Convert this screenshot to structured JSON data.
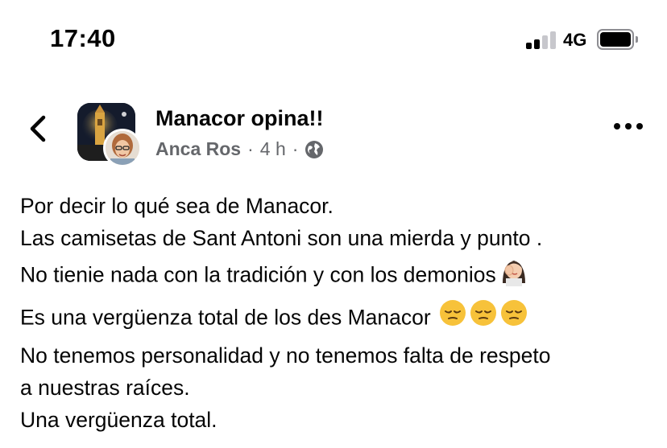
{
  "status_bar": {
    "time": "17:40",
    "network": "4G",
    "signal_icon": "cellular-signal-icon",
    "battery_icon": "battery-icon"
  },
  "header": {
    "back_icon": "chevron-left-icon",
    "group_name": "Manacor opina!!",
    "author": "Anca Ros",
    "separator_1": "·",
    "time_ago": "4 h",
    "separator_2": "·",
    "privacy_icon": "globe-icon",
    "more_icon": "more-horizontal-icon"
  },
  "post": {
    "lines": [
      "Por decir lo qué sea de Manacor.",
      "Las camisetas de Sant Antoni son una mierda y punto .",
      "No tienie nada con la tradición y con los demonios",
      "Es una vergüenza total de los des Manacor",
      "No tenemos personalidad y no tenemos falta de respeto",
      "a nuestras raíces.",
      "Una vergüenza total."
    ],
    "emoji_line3": "woman-facepalming-emoji",
    "emoji_line4": [
      "pensive-face-emoji",
      "pensive-face-emoji",
      "pensive-face-emoji"
    ]
  },
  "colors": {
    "text_primary": "#050505",
    "text_secondary": "#65676b",
    "background": "#ffffff"
  }
}
